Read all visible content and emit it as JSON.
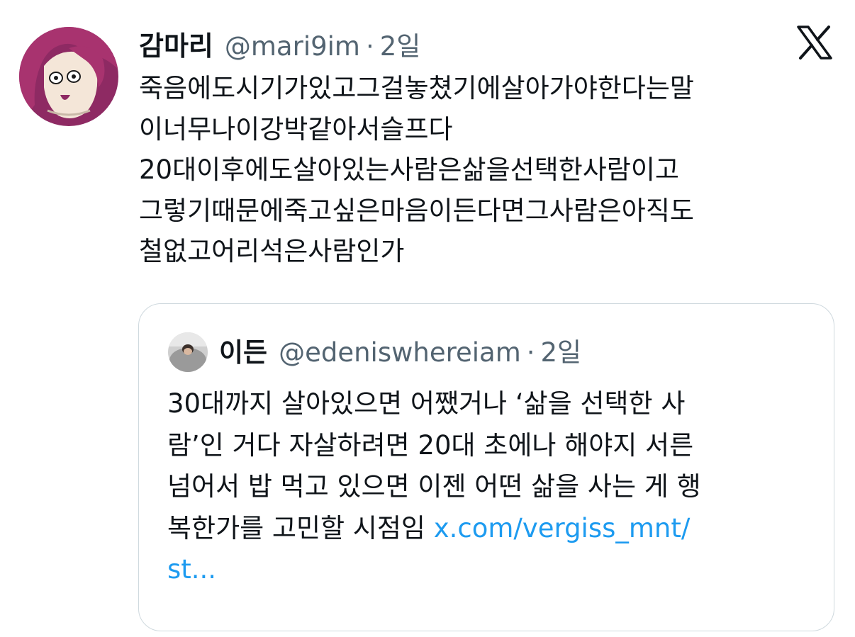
{
  "tweet": {
    "author_name": "감마리",
    "handle": "@mari9im",
    "separator": "·",
    "time": "2일",
    "lines": [
      "죽음에도시기가있고그걸놓쳤기에살아가야한다는말",
      "이너무나이강박같아서슬프다",
      "20대이후에도살아있는사람은삶을선택한사람이고",
      "그렇기때문에죽고싶은마음이든다면그사람은아직도",
      "철없고어리석은사람인가"
    ],
    "icons": {
      "logo": "x-logo-icon",
      "avatar": "avatar-image"
    }
  },
  "quote": {
    "author_name": "이든",
    "handle": "@edeniswhereiam",
    "separator": "·",
    "time": "2일",
    "lines": [
      "30대까지 살아있으면 어쨌거나 ‘삶을 선택한 사",
      "람’인 거다 자살하려면 20대 초에나 해야지 서른",
      "넘어서 밥 먹고 있으면 이젠 어떤 삶을 사는 게 행"
    ],
    "last_line_text": "복한가를 고민할 시점임",
    "link_part1": "x.com/vergiss_mnt/",
    "link_part2": "st..."
  },
  "colors": {
    "text": "#0f1419",
    "secondary": "#536471",
    "link": "#1d9bf0",
    "border": "#cfd9de"
  }
}
